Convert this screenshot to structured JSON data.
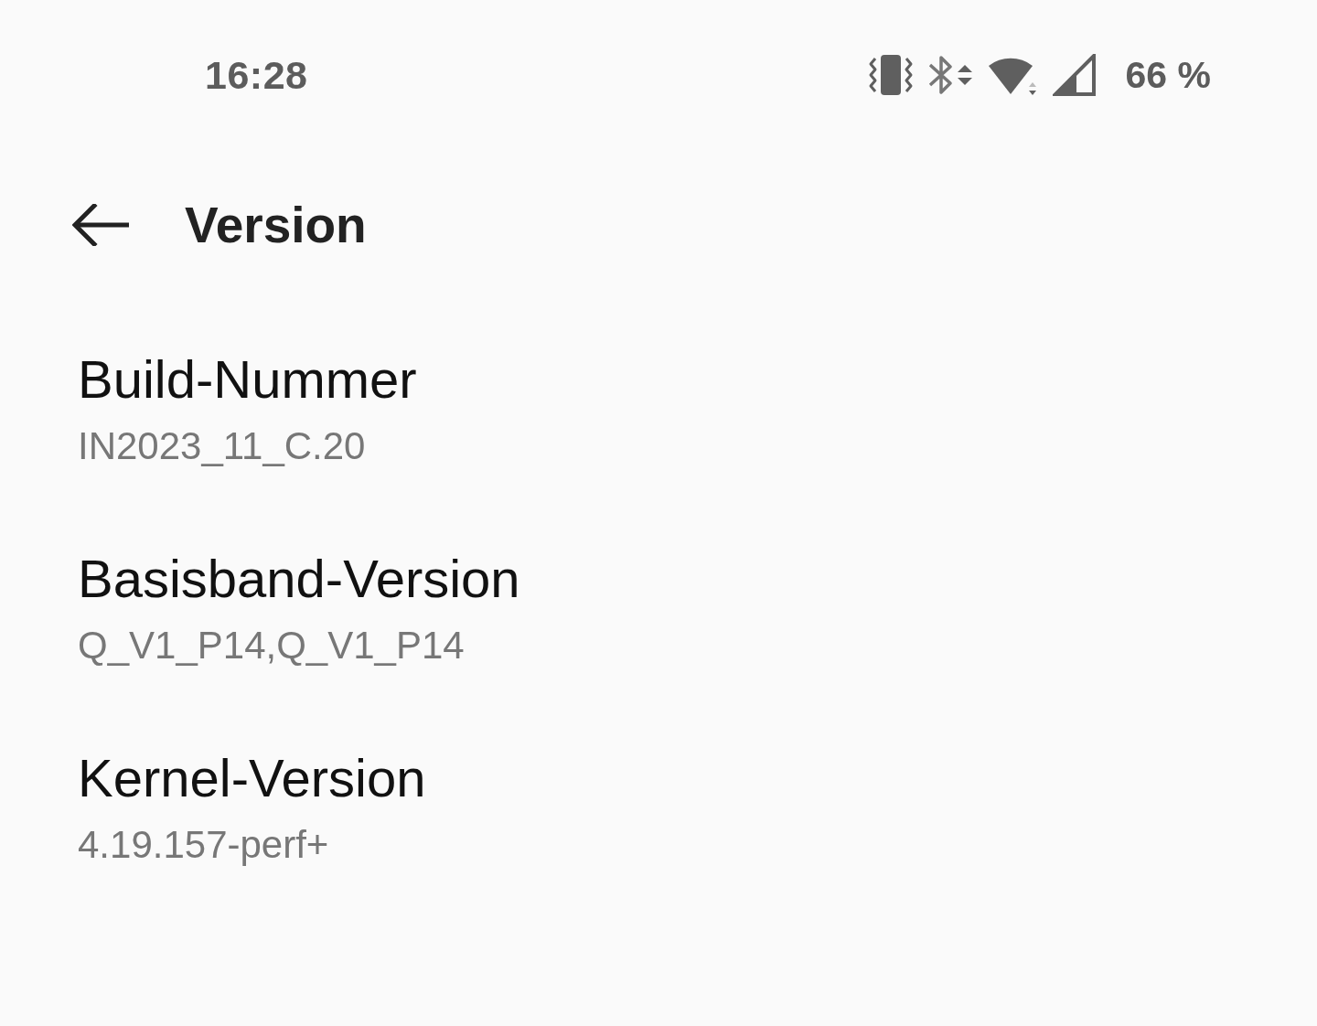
{
  "status_bar": {
    "time": "16:28",
    "battery": "66 %"
  },
  "header": {
    "title": "Version"
  },
  "items": [
    {
      "title": "Build-Nummer",
      "value": "IN2023_11_C.20"
    },
    {
      "title": "Basisband-Version",
      "value": "Q_V1_P14,Q_V1_P14"
    },
    {
      "title": "Kernel-Version",
      "value": "4.19.157-perf+"
    }
  ]
}
